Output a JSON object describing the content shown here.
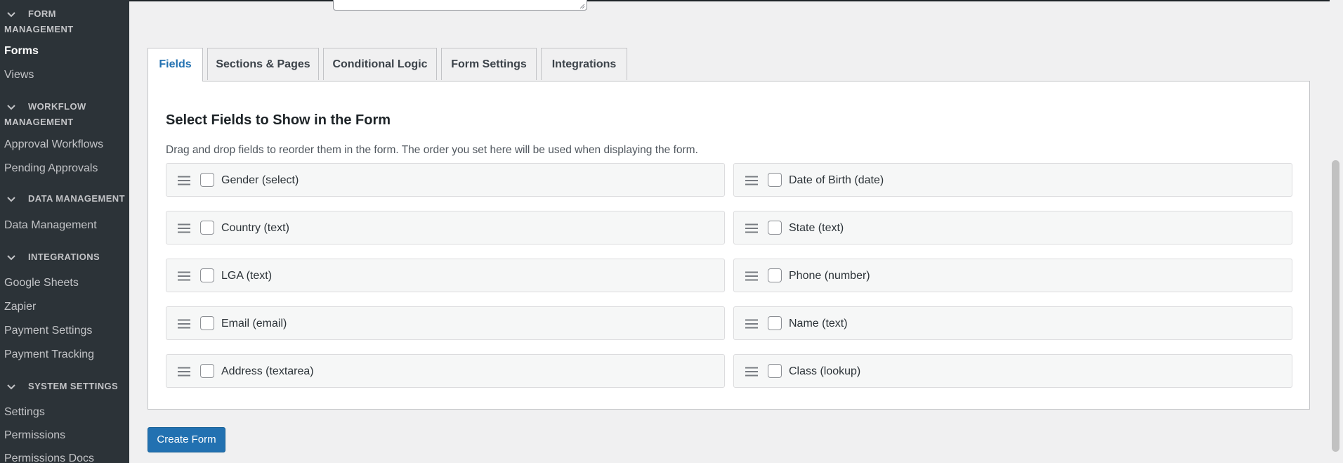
{
  "sidebar": {
    "groups": [
      {
        "heading": "Form Management",
        "items": [
          {
            "label": "Forms",
            "current": true
          },
          {
            "label": "Views",
            "current": false
          }
        ]
      },
      {
        "heading": "Workflow Management",
        "items": [
          {
            "label": "Approval Workflows",
            "current": false
          },
          {
            "label": "Pending Approvals",
            "current": false
          }
        ]
      },
      {
        "heading": "Data Management",
        "items": [
          {
            "label": "Data Management",
            "current": false
          }
        ]
      },
      {
        "heading": "Integrations",
        "items": [
          {
            "label": "Google Sheets",
            "current": false
          },
          {
            "label": "Zapier",
            "current": false
          },
          {
            "label": "Payment Settings",
            "current": false
          },
          {
            "label": "Payment Tracking",
            "current": false
          }
        ]
      },
      {
        "heading": "System Settings",
        "items": [
          {
            "label": "Settings",
            "current": false
          },
          {
            "label": "Permissions",
            "current": false
          },
          {
            "label": "Permissions Docs",
            "current": false
          }
        ]
      }
    ],
    "colors": {
      "background": "#2c3338",
      "text": "#c3c4c7",
      "current_text": "#ffffff"
    }
  },
  "tabs": [
    {
      "label": "Fields",
      "active": true
    },
    {
      "label": "Sections & Pages",
      "active": false
    },
    {
      "label": "Conditional Logic",
      "active": false
    },
    {
      "label": "Form Settings",
      "active": false
    },
    {
      "label": "Integrations",
      "active": false
    }
  ],
  "panel": {
    "title": "Select Fields to Show in the Form",
    "description": "Drag and drop fields to reorder them in the form. The order you set here will be used when displaying the form.",
    "fields": [
      {
        "label": "Gender (select)",
        "checked": false
      },
      {
        "label": "Date of Birth (date)",
        "checked": false
      },
      {
        "label": "Country (text)",
        "checked": false
      },
      {
        "label": "State (text)",
        "checked": false
      },
      {
        "label": "LGA (text)",
        "checked": false
      },
      {
        "label": "Phone (number)",
        "checked": false
      },
      {
        "label": "Email (email)",
        "checked": false
      },
      {
        "label": "Name (text)",
        "checked": false
      },
      {
        "label": "Address (textarea)",
        "checked": false
      },
      {
        "label": "Class (lookup)",
        "checked": false
      }
    ]
  },
  "actions": {
    "create_form_label": "Create Form"
  },
  "colors": {
    "accent": "#2271b1",
    "page_background": "#f0f0f1"
  },
  "icons": {
    "group_toggle": "chevron-down-icon",
    "field_handle": "drag-handle-icon"
  }
}
